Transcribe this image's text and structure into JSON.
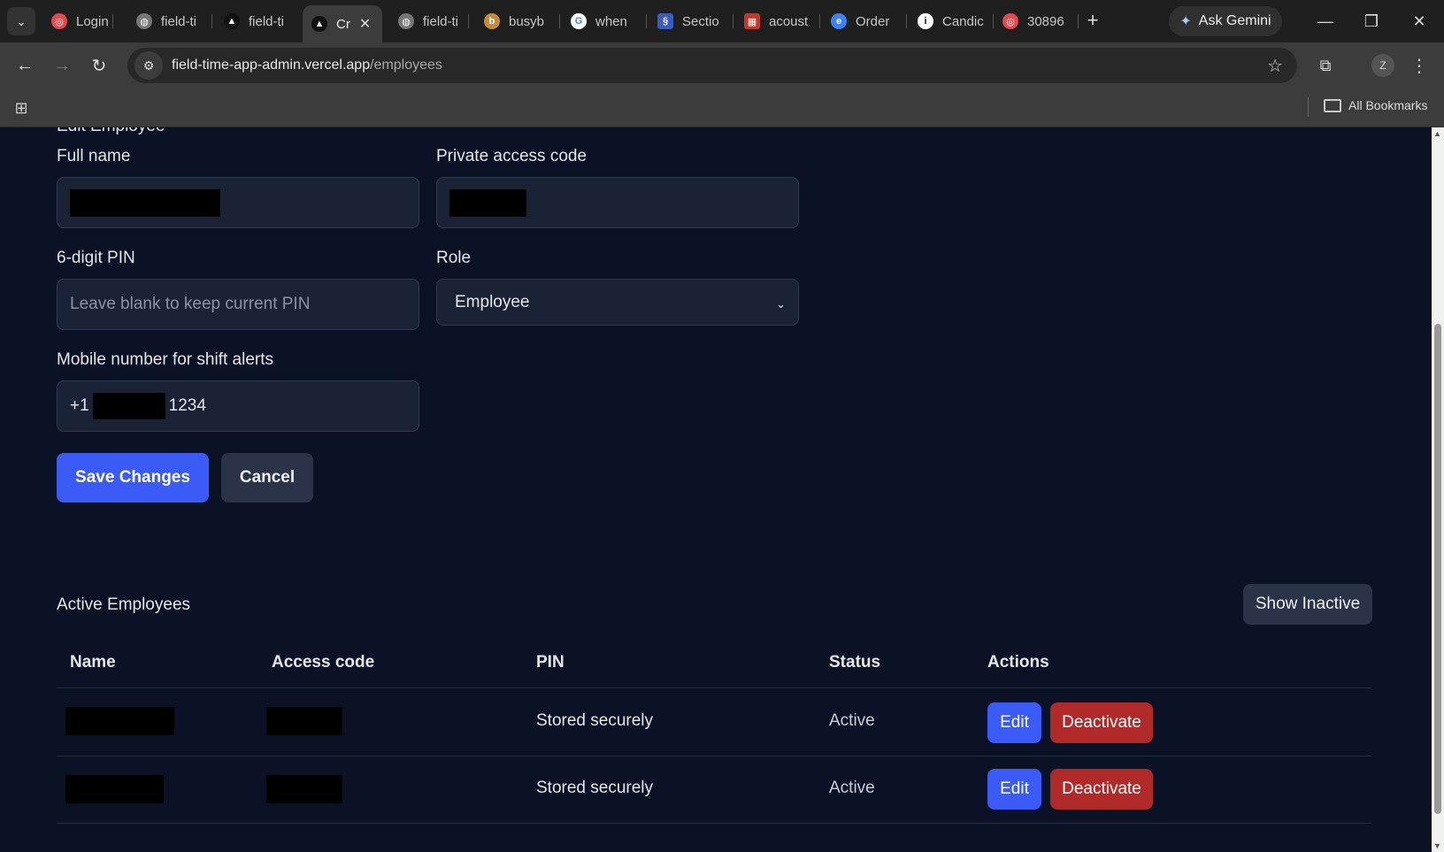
{
  "browser": {
    "tabs": [
      {
        "label": "Login",
        "icon": "target-icon",
        "color": "#e5484d"
      },
      {
        "label": "field-ti",
        "icon": "globe-icon",
        "color": "#777777"
      },
      {
        "label": "field-ti",
        "icon": "vercel-icon",
        "color": "#111111"
      },
      {
        "label": "Cr",
        "icon": "vercel-icon",
        "color": "#111111",
        "active": true
      },
      {
        "label": "field-ti",
        "icon": "globe-icon",
        "color": "#777777"
      },
      {
        "label": "busyb",
        "icon": "b-icon",
        "color": "#c58a3c"
      },
      {
        "label": "when",
        "icon": "google-icon",
        "color": "#ffffff"
      },
      {
        "label": "Sectio",
        "icon": "s-icon",
        "color": "#3a5bbf"
      },
      {
        "label": "acoust",
        "icon": "calendar-icon",
        "color": "#c0392b"
      },
      {
        "label": "Order",
        "icon": "edge-icon",
        "color": "#3b82f6"
      },
      {
        "label": "Candic",
        "icon": "info-icon",
        "color": "#ffffff"
      },
      {
        "label": "30896",
        "icon": "target-icon",
        "color": "#e5484d"
      }
    ],
    "ask_gemini": "Ask Gemini",
    "url_host": "field-time-app-admin.vercel.app",
    "url_path": "/employees",
    "profile_initial": "Z",
    "all_bookmarks": "All Bookmarks"
  },
  "form": {
    "title": "Edit Employee",
    "full_name_label": "Full name",
    "access_code_label": "Private access code",
    "pin_label": "6-digit PIN",
    "pin_placeholder": "Leave blank to keep current PIN",
    "role_label": "Role",
    "role_value": "Employee",
    "mobile_label": "Mobile number for shift alerts",
    "mobile_prefix": "+1",
    "mobile_suffix": "1234",
    "save_label": "Save Changes",
    "cancel_label": "Cancel"
  },
  "employees": {
    "title": "Active Employees",
    "show_inactive_label": "Show Inactive",
    "columns": [
      "Name",
      "Access code",
      "PIN",
      "Status",
      "Actions"
    ],
    "rows": [
      {
        "pin": "Stored securely",
        "status": "Active",
        "edit": "Edit",
        "deactivate": "Deactivate"
      },
      {
        "pin": "Stored securely",
        "status": "Active",
        "edit": "Edit",
        "deactivate": "Deactivate"
      }
    ]
  },
  "colors": {
    "page_bg": "#0b1226",
    "primary": "#3b5bf6",
    "danger": "#b02a2a"
  }
}
